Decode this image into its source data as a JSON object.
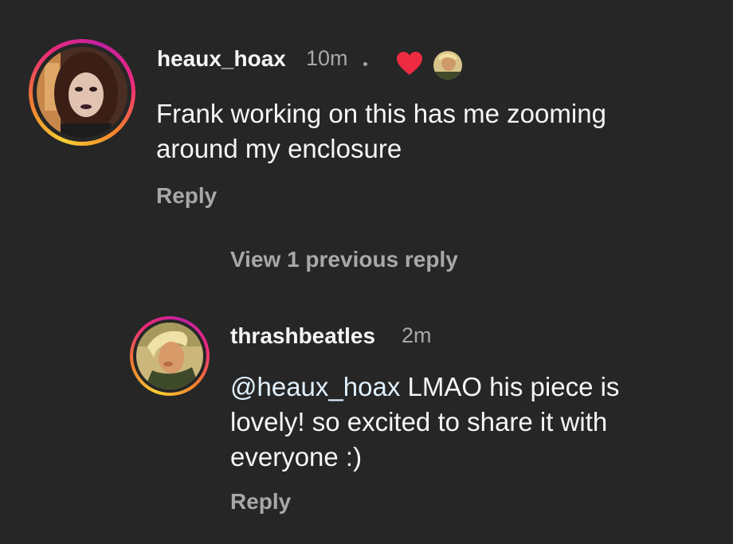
{
  "comments": [
    {
      "username": "heaux_hoax",
      "time": "10m",
      "text": "Frank working on this has me zooming around my enclosure",
      "text_line1": "Frank working on this has me zooming",
      "text_line2": "around my enclosure",
      "reply_label": "Reply",
      "liked_by_author": true
    }
  ],
  "view_replies_label": "View 1 previous reply",
  "replies": [
    {
      "username": "thrashbeatles",
      "time": "2m",
      "mention": "@heaux_hoax",
      "text_after_mention": " LMAO his piece is",
      "text_line2": "lovely! so excited to share it with",
      "text_line3": "everyone :)",
      "reply_label": "Reply"
    }
  ],
  "colors": {
    "background": "#262626",
    "primary_text": "#f5f5f5",
    "secondary_text": "#a8a8a8",
    "mention": "#e0f1ff",
    "heart": "#ed2b41"
  },
  "icons": {
    "heart": "heart-icon",
    "creator_avatar": "creator-like-avatar"
  }
}
